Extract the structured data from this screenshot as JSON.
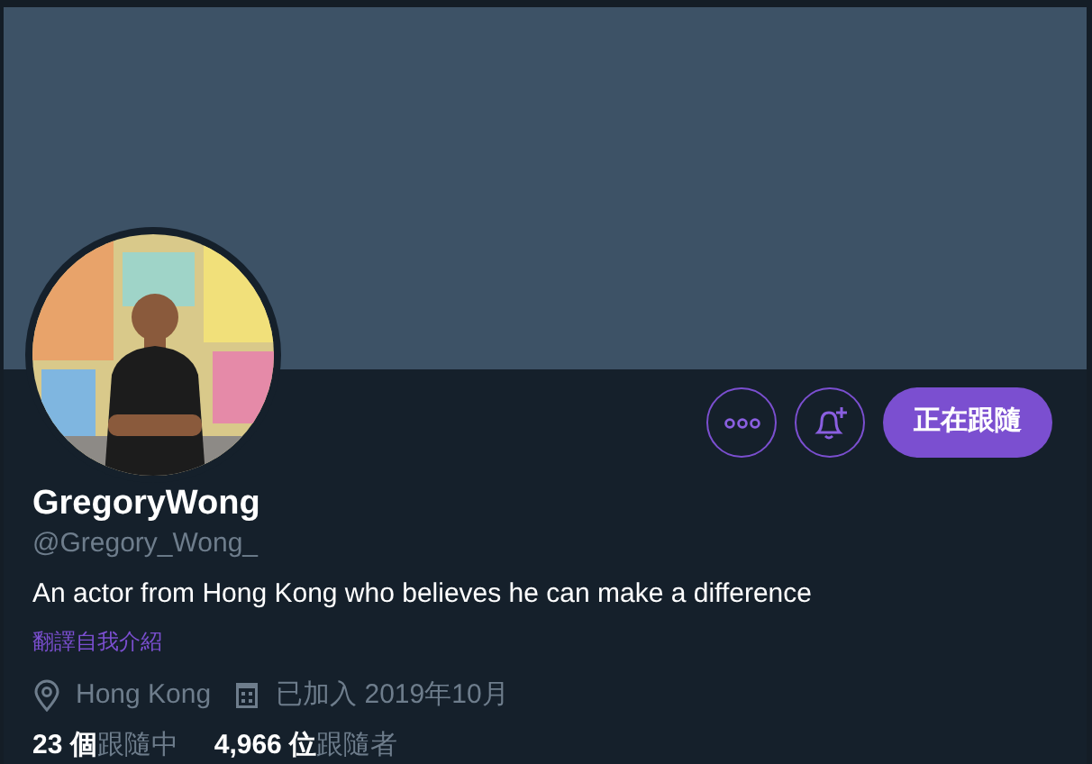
{
  "profile": {
    "name": "GregoryWong",
    "handle": "@Gregory_Wong_",
    "bio": "An actor from Hong Kong who believes he can make a difference",
    "translate_link": "翻譯自我介紹",
    "location": "Hong Kong",
    "joined": "已加入 2019年10月"
  },
  "actions": {
    "following": true,
    "follow_label": "正在跟隨"
  },
  "stats": [
    {
      "count": "23 個",
      "label": "跟隨中"
    },
    {
      "count": "4,966 位",
      "label": "跟隨者"
    }
  ]
}
